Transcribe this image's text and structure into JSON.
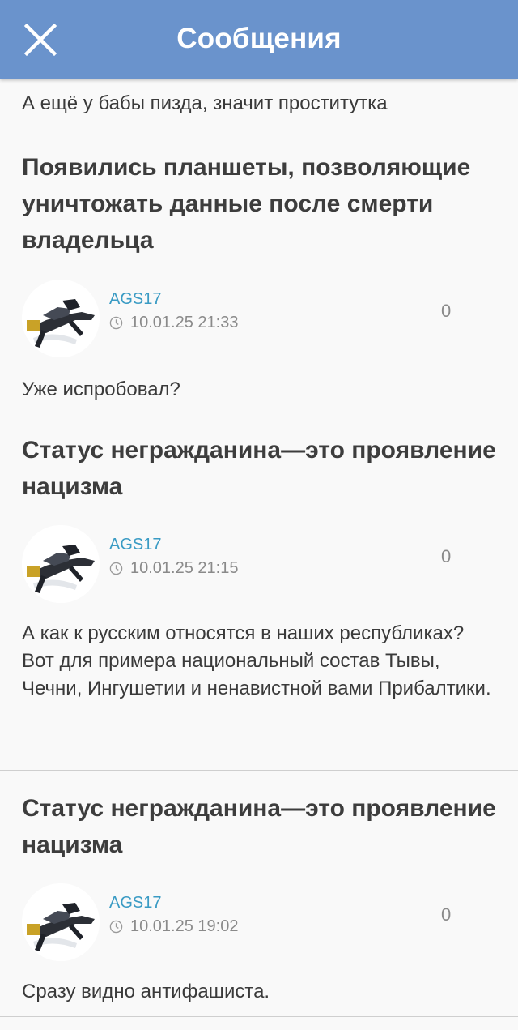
{
  "header": {
    "title": "Сообщения",
    "close_icon": "close-icon"
  },
  "top_snippet": "А ещё у бабы пизда, значит проститутка",
  "posts": [
    {
      "title": "Появились планшеты, позволяющие уничтожать данные после смерти владельца",
      "author": "AGS17",
      "time": "10.01.25 21:33",
      "rating": "0",
      "snippet": "Уже испробовал?"
    },
    {
      "title": "Статус негражданина—это проявление нацизма",
      "author": "AGS17",
      "time": "10.01.25 21:15",
      "rating": "0",
      "snippet": "А как к русским относятся в наших республиках?\nВот для примера национальный состав Тывы, Чечни, Ингушетии и ненавистной вами Прибалтики."
    },
    {
      "title": "Статус негражданина—это проявление нацизма",
      "author": "AGS17",
      "time": "10.01.25 19:02",
      "rating": "0",
      "snippet": "Сразу видно антифашиста."
    }
  ],
  "colors": {
    "app_bar": "#6a93cc",
    "link": "#3a9bc4",
    "muted": "#8a8a8a",
    "background": "#f9f9f9"
  }
}
